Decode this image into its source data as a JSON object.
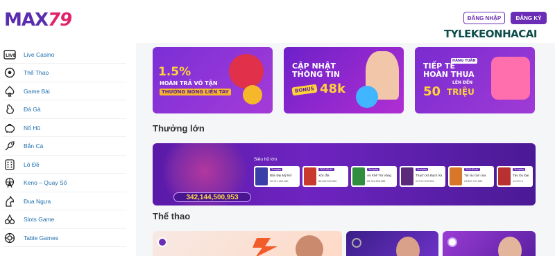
{
  "header": {
    "logo_text": "MAX",
    "logo_num": "79",
    "login_label": "ĐĂNG NHẬP",
    "register_label": "ĐĂNG KÝ",
    "watermark": "TYLEKEONHACAI"
  },
  "sidebar": {
    "items": [
      {
        "label": "Live Casino",
        "icon": "live-icon"
      },
      {
        "label": "Thể Thao",
        "icon": "soccer-ball-icon"
      },
      {
        "label": "Game Bài",
        "icon": "spade-icon"
      },
      {
        "label": "Đá Gà",
        "icon": "rooster-icon"
      },
      {
        "label": "Nổ Hũ",
        "icon": "piggy-bank-icon"
      },
      {
        "label": "Bắn Cá",
        "icon": "fish-icon"
      },
      {
        "label": "Lô Đề",
        "icon": "dice-grid-icon"
      },
      {
        "label": "Keno – Quay Số",
        "icon": "ferris-wheel-icon"
      },
      {
        "label": "Đua Ngựa",
        "icon": "horse-icon"
      },
      {
        "label": "Slots Game",
        "icon": "cherry-icon"
      },
      {
        "label": "Table Games",
        "icon": "chip-icon"
      }
    ]
  },
  "banners": [
    {
      "pct": "1.5%",
      "line1": "HOÀN TRẢ VÔ TẬN",
      "line2": "THƯỞNG NÓNG LIỀN TAY"
    },
    {
      "line1": "CẬP NHẬT",
      "line2": "THÔNG TIN",
      "bonus": "BONUS",
      "amount": "48k"
    },
    {
      "line1": "TIẾP TẾ",
      "line2": "HOÀN THUA",
      "tag": "HÀNG TUẦN",
      "tag2": "LÊN ĐẾN",
      "amount": "50",
      "unit": "TRIỆU"
    }
  ],
  "sections": {
    "big_reward": "Thưởng lớn",
    "sports": "Thể thao"
  },
  "jackpot": {
    "label": "Siêu hũ lớn",
    "amount": "342,144,500,953",
    "games": [
      {
        "tag": "Techplay",
        "name": "Bắn Đại Mỹ Nữ",
        "value": "96.747.152.180"
      },
      {
        "tag": "TECHPLAY",
        "name": "Xóc đĩa",
        "value": "86.462.910.050"
      },
      {
        "tag": "Techplay",
        "name": "An Khê Trả Vàng",
        "value": "65.754.609.588"
      },
      {
        "tag": "Techplay",
        "name": "Thạch Xà Bạch Xà",
        "value": "23.972.975.996"
      },
      {
        "tag": "TECHPLAY",
        "name": "Tài xỉu cân cửa",
        "value": "23.857.747.089"
      },
      {
        "tag": "Techplay",
        "name": "Tàu Du Đại",
        "value": "14.972.0"
      }
    ]
  }
}
